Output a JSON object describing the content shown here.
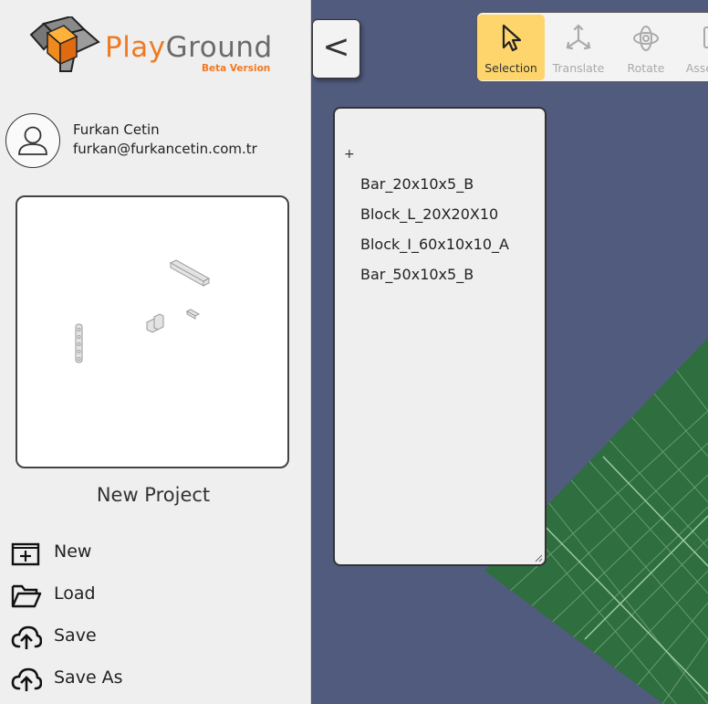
{
  "app": {
    "logo_part1": "Play",
    "logo_part2": "Ground",
    "logo_badge": "Beta Version"
  },
  "user": {
    "name": "Furkan Cetin",
    "email": "furkan@furkancetin.com.tr"
  },
  "project": {
    "title": "New Project"
  },
  "menu": {
    "new_label": "New",
    "load_label": "Load",
    "save_label": "Save",
    "save_as_label": "Save As"
  },
  "collapse_label": "<",
  "toolbar": {
    "tools": [
      {
        "label": "Selection",
        "icon": "cursor-icon",
        "active": true
      },
      {
        "label": "Translate",
        "icon": "translate-axes-icon",
        "active": false
      },
      {
        "label": "Rotate",
        "icon": "rotate-icon",
        "active": false
      },
      {
        "label": "Assemble",
        "icon": "assemble-icon",
        "active": false
      }
    ]
  },
  "parts": {
    "add_symbol": "+",
    "items": [
      "Bar_20x10x5_B",
      "Block_L_20X20X10",
      "Block_I_60x10x10_A",
      "Bar_50x10x5_B"
    ]
  },
  "colors": {
    "background": "#515b7e",
    "ground": "#2f6e3e",
    "accent": "#f07a22",
    "active_tool": "#fdd56c"
  }
}
